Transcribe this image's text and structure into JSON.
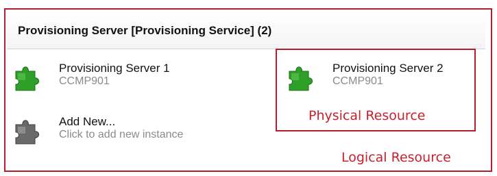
{
  "panel": {
    "title": "Provisioning Server [Provisioning Service] (2)"
  },
  "items": [
    {
      "name": "Provisioning Server 1",
      "host": "CCMP901",
      "icon": "green-puzzle-icon"
    },
    {
      "name": "Provisioning Server 2",
      "host": "CCMP901",
      "icon": "green-puzzle-icon"
    }
  ],
  "add_new": {
    "name": "Add New...",
    "hint": "Click to add new instance",
    "icon": "gray-puzzle-icon"
  },
  "annotations": {
    "physical": "Physical Resource",
    "logical": "Logical Resource"
  },
  "colors": {
    "annotation_red": "#c8202e",
    "frame_red": "#b31c2a",
    "icon_green": "#2ea02a",
    "icon_gray": "#6a6a6a"
  }
}
